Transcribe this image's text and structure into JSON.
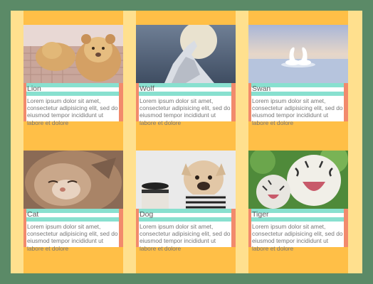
{
  "cards": [
    {
      "title": "Lion",
      "text": "Lorem ipsum dolor sit amet, consectetur adipisicing elit, sed do eiusmod tempor incididunt ut labore et dolore",
      "photo": "lion-cub-photo"
    },
    {
      "title": "Wolf",
      "text": "Lorem ipsum dolor sit amet, consectetur adipisicing elit, sed do eiusmod tempor incididunt ut labore et dolore",
      "photo": "howling-wolf-photo"
    },
    {
      "title": "Swan",
      "text": "Lorem ipsum dolor sit amet, consectetur adipisicing elit, sed do eiusmod tempor incididunt ut labore et dolore",
      "photo": "swans-photo"
    },
    {
      "title": "Cat",
      "text": "Lorem ipsum dolor sit amet, consectetur adipisicing elit, sed do eiusmod tempor incididunt ut labore et dolore",
      "photo": "sleeping-cat-photo"
    },
    {
      "title": "Dog",
      "text": "Lorem ipsum dolor sit amet, consectetur adipisicing elit, sed do eiusmod tempor incididunt ut labore et dolore",
      "photo": "bulldog-photo"
    },
    {
      "title": "Tiger",
      "text": "Lorem ipsum dolor sit amet, consectetur adipisicing elit, sed do eiusmod tempor incididunt ut labore et dolore",
      "photo": "white-tigers-photo"
    }
  ],
  "colors": {
    "outer_bg": "#5b8a67",
    "frame": "#ffe08e",
    "column": "#ffbf47",
    "accent_teal": "#88e0cf",
    "accent_coral": "#f28a6c"
  }
}
